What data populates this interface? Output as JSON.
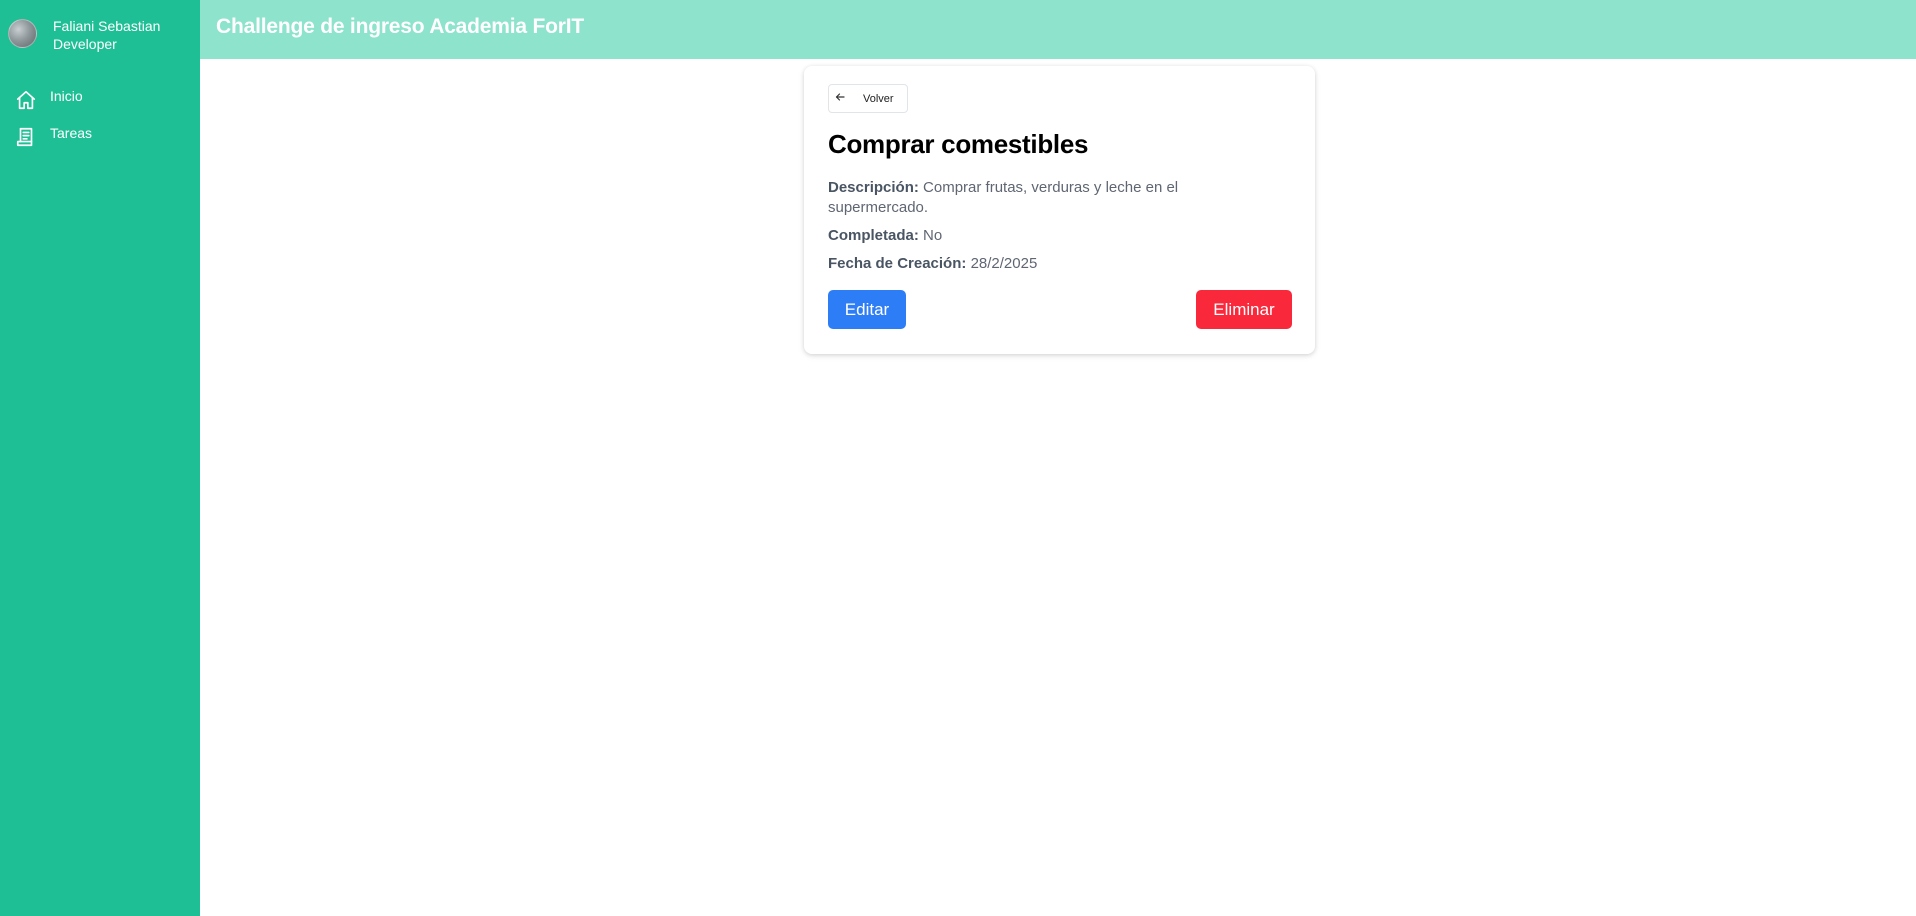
{
  "sidebar": {
    "profile": {
      "name": "Faliani Sebastian",
      "role": "Developer"
    },
    "items": [
      {
        "label": "Inicio",
        "icon": "home-icon"
      },
      {
        "label": "Tareas",
        "icon": "document-icon"
      }
    ]
  },
  "header": {
    "title": "Challenge de ingreso Academia ForIT"
  },
  "task": {
    "back_label": "Volver",
    "title": "Comprar comestibles",
    "description_label": "Descripción:",
    "description": "Comprar frutas, verduras y leche en el supermercado.",
    "completed_label": "Completada:",
    "completed": "No",
    "created_label": "Fecha de Creación:",
    "created": "28/2/2025",
    "edit_label": "Editar",
    "delete_label": "Eliminar"
  },
  "colors": {
    "sidebar": "#1fbf95",
    "header": "#8de3cb",
    "edit_button": "#2d7df6",
    "delete_button": "#f9283b"
  }
}
